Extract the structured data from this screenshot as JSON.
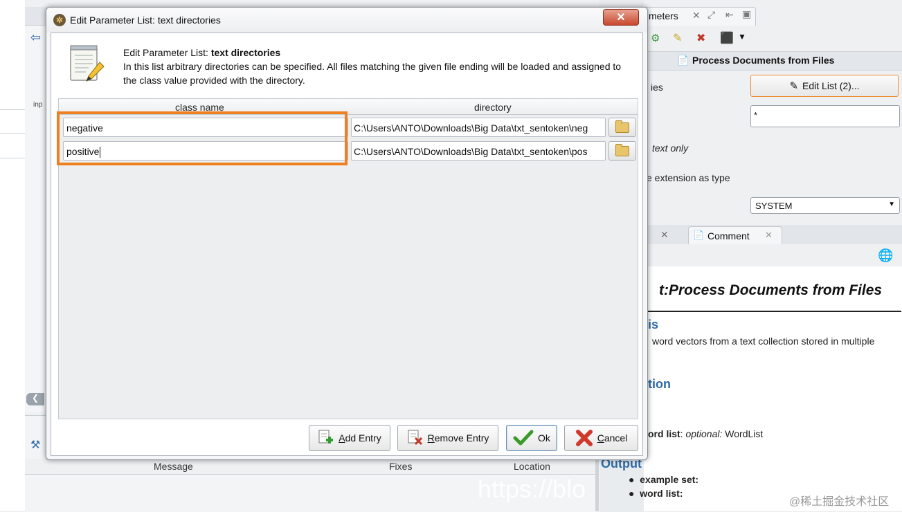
{
  "dialog": {
    "title": "Edit Parameter List: text directories",
    "close_label": "✕",
    "description": {
      "title_prefix": "Edit Parameter List: ",
      "title_bold": "text directories",
      "text": "In this list arbitrary directories can be specified. All files matching the given file ending will be loaded and assigned to the class value provided with the directory."
    },
    "table": {
      "headers": [
        "class name",
        "directory"
      ],
      "rows": [
        {
          "class_name": "negative",
          "directory": "C:\\Users\\ANTO\\Downloads\\Big Data\\txt_sentoken\\neg"
        },
        {
          "class_name": "positive",
          "directory": "C:\\Users\\ANTO\\Downloads\\Big Data\\txt_sentoken\\pos"
        }
      ]
    },
    "buttons": {
      "add_hot": "A",
      "add_rest": "dd Entry",
      "remove_hot": "R",
      "remove_rest": "emove Entry",
      "ok": "Ok",
      "cancel_hot": "C",
      "cancel_rest": "ancel"
    }
  },
  "background": {
    "params_tab": "meters",
    "left_label": "inp",
    "process_title": "Process Documents from Files",
    "edit_list_label": "Edit List (2)...",
    "param_label_1": "ies",
    "extension_value": "*",
    "param_label_2": "text only",
    "param_label_3": "e extension as type",
    "encoding_value": "SYSTEM",
    "comment_tab": "Comment",
    "help": {
      "title": "t:Process Documents from Files",
      "heading_1": "is",
      "text_1": "word vectors from a text collection stored in multiple",
      "heading_2": "tion",
      "input_bold": "ord list",
      "input_italic": "optional:",
      "input_rest": " WordList",
      "output_heading": "Output",
      "out_1": "example set",
      "out_2": "word list"
    },
    "problems": {
      "headers": [
        "Message",
        "Fixes",
        "Location"
      ]
    },
    "watermark": "https://blo",
    "juejin": "@稀土掘金技术社区"
  },
  "colors": {
    "highlight": "#f07f1f",
    "help_heading": "#2f6aa6"
  }
}
